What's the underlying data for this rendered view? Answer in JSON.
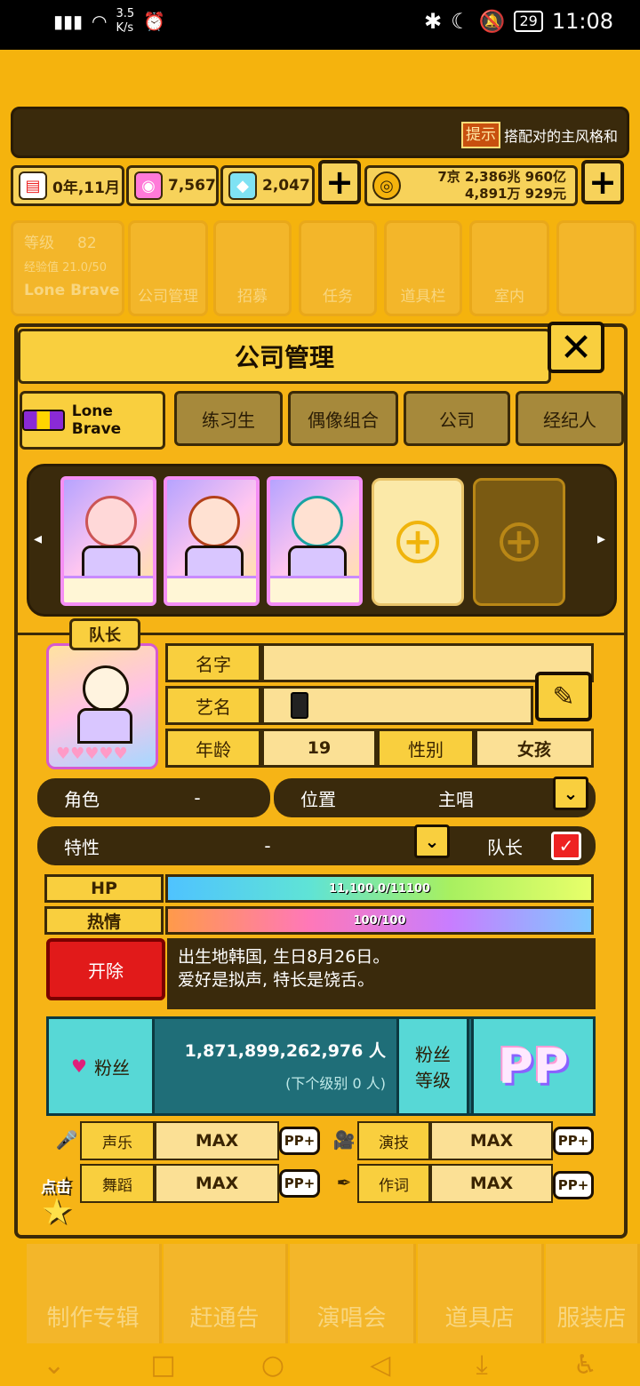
{
  "status": {
    "speed": "3.5\nK/s",
    "battery": "29",
    "time": "11:08"
  },
  "hint": {
    "badge": "提示",
    "text": "搭配对的主风格和"
  },
  "resources": {
    "date": "0年,11月",
    "pink_gems": "7,567",
    "diamonds": "2,047",
    "money_line1": "7京 2,386兆 960亿",
    "money_line2": "4,891万 929元",
    "plus": "+"
  },
  "bg_menu": [
    "等级",
    "82",
    "经验值 21.0/50",
    "Lone Brave",
    "公司管理",
    "招募",
    "任务",
    "道具栏",
    "室内"
  ],
  "panel": {
    "title": "公司管理",
    "close": "✕"
  },
  "tabs": [
    "Lone Brave",
    "练习生",
    "偶像组合",
    "公司",
    "经纪人"
  ],
  "strip": {
    "add": "+"
  },
  "member": {
    "leader_tag": "队长",
    "name_label": "名字",
    "stage_label": "艺名",
    "age_label": "年龄",
    "age": "19",
    "gender_label": "性别",
    "gender": "女孩",
    "role_label": "角色",
    "role": "-",
    "position_label": "位置",
    "position": "主唱",
    "trait_label": "特性",
    "trait": "-",
    "leader_label": "队长",
    "hp_label": "HP",
    "hp_text": "11,100.0/11100",
    "passion_label": "热情",
    "passion_text": "100/100",
    "fire": "开除",
    "bio_line1": "出生地韩国, 生日8月26日。",
    "bio_line2": "爱好是拟声, 特长是饶舌。"
  },
  "fans": {
    "label": "粉丝",
    "count": "1,871,899,262,976 人",
    "next": "(下个级别 0 人)",
    "level_label_1": "粉丝",
    "level_label_2": "等级",
    "pp": "PP"
  },
  "skills": {
    "vocal": "声乐",
    "acting": "演技",
    "dance": "舞蹈",
    "lyrics": "作词",
    "max": "MAX",
    "pp": "PP+",
    "tap": "点击"
  },
  "bottom_nav": [
    "制作专辑",
    "赶通告",
    "演唱会",
    "道具店",
    "服装店"
  ],
  "colors": {
    "hp_bar": "#5fe3d6",
    "accent": "#f9cf3e",
    "panel": "#f6b416",
    "dark": "#3a2a0c",
    "fire": "#e11a1a",
    "teal": "#57d8d6"
  }
}
